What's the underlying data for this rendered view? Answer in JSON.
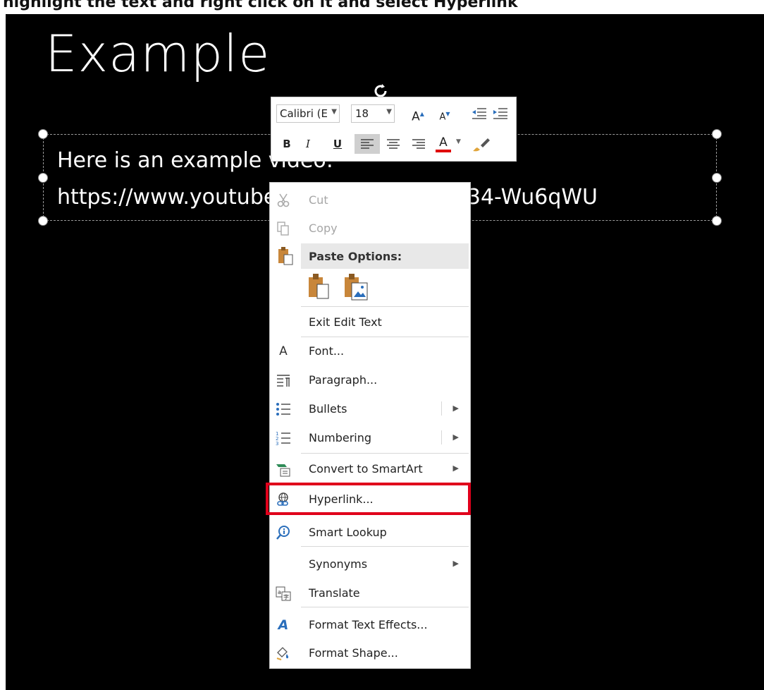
{
  "caption": "highlight the text and right click on it and select Hyperlink",
  "slide": {
    "title": "Example",
    "textbox": {
      "line1": "Here is an example video:",
      "line2": "https://www.youtube.com/watch?v=XF34-Wu6qWU"
    }
  },
  "minibar": {
    "font": "Calibri (E",
    "size": "18",
    "grow_label": "A",
    "shrink_label": "A",
    "bold": "B",
    "italic": "I",
    "underline": "U",
    "font_color_label": "A",
    "font_color": "#e00000"
  },
  "context_menu": {
    "cut": "Cut",
    "copy": "Copy",
    "paste_options": "Paste Options:",
    "exit_edit": "Exit Edit Text",
    "font": "Font...",
    "paragraph": "Paragraph...",
    "bullets": "Bullets",
    "numbering": "Numbering",
    "smartart": "Convert to SmartArt",
    "hyperlink": "Hyperlink...",
    "smart_lookup": "Smart Lookup",
    "synonyms": "Synonyms",
    "translate": "Translate",
    "text_effects": "Format Text Effects...",
    "format_shape": "Format Shape..."
  },
  "highlight_color": "#e0001b"
}
